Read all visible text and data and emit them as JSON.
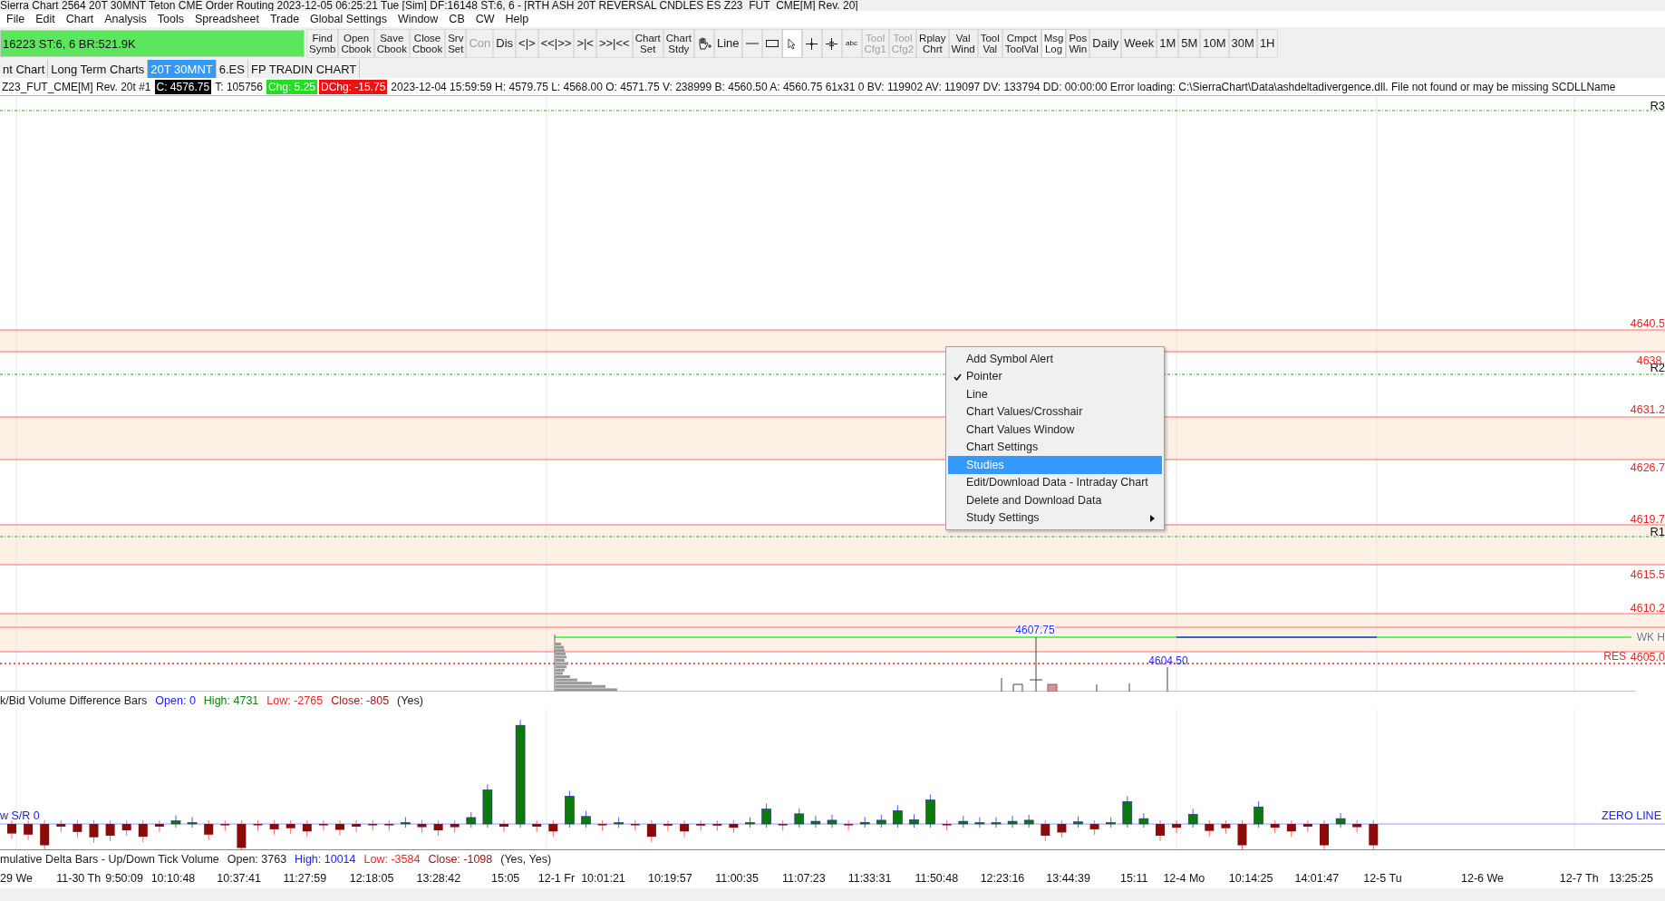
{
  "window": {
    "title": "Sierra Chart 2564 20T 30MNT Teton CME Order Routing 2023-12-05  06:25:21 Tue [Sim]  DF:16148  ST:6, 6 - [RTH ASH 20T REVERSAL CNDLES ES Z23_FUT_CME[M]  Rev. 20]"
  },
  "menu": [
    "File",
    "Edit",
    "Chart",
    "Analysis",
    "Tools",
    "Spreadsheet",
    "Trade",
    "Global Settings",
    "Window",
    "CB",
    "CW",
    "Help"
  ],
  "status_field": "16223  ST:6, 6  BR:521.9K",
  "toolbar": [
    {
      "kind": "text",
      "lines": [
        "Find",
        "Symb"
      ],
      "disabled": false,
      "pressed": false
    },
    {
      "kind": "text",
      "lines": [
        "Open",
        "Cbook"
      ],
      "disabled": false,
      "pressed": false
    },
    {
      "kind": "text",
      "lines": [
        "Save",
        "Cbook"
      ],
      "disabled": false,
      "pressed": false
    },
    {
      "kind": "text",
      "lines": [
        "Close",
        "Cbook"
      ],
      "disabled": false,
      "pressed": false
    },
    {
      "kind": "text",
      "lines": [
        "Srv",
        "Set"
      ],
      "disabled": false,
      "pressed": false
    },
    {
      "kind": "text",
      "lines": [
        "Con"
      ],
      "disabled": true,
      "pressed": false
    },
    {
      "kind": "text",
      "lines": [
        "Dis"
      ],
      "disabled": false,
      "pressed": false
    },
    {
      "kind": "text",
      "lines": [
        "<|>"
      ],
      "disabled": false,
      "pressed": false
    },
    {
      "kind": "text",
      "lines": [
        "<<|>>"
      ],
      "disabled": false,
      "pressed": false
    },
    {
      "kind": "text",
      "lines": [
        ">|<"
      ],
      "disabled": false,
      "pressed": false
    },
    {
      "kind": "text",
      "lines": [
        ">>|<<"
      ],
      "disabled": false,
      "pressed": false
    },
    {
      "kind": "text",
      "lines": [
        "Chart",
        "Set"
      ],
      "disabled": false,
      "pressed": false
    },
    {
      "kind": "text",
      "lines": [
        "Chart",
        "Stdy"
      ],
      "disabled": false,
      "pressed": false
    },
    {
      "kind": "hand",
      "disabled": false,
      "pressed": false
    },
    {
      "kind": "text",
      "lines": [
        "Line"
      ],
      "disabled": false,
      "pressed": false
    },
    {
      "kind": "dash",
      "disabled": false,
      "pressed": false
    },
    {
      "kind": "rectangle",
      "disabled": false,
      "pressed": false
    },
    {
      "kind": "pointer",
      "disabled": false,
      "pressed": true
    },
    {
      "kind": "crosshair",
      "disabled": false,
      "pressed": false
    },
    {
      "kind": "cross",
      "disabled": false,
      "pressed": false
    },
    {
      "kind": "small",
      "lines": [
        "abc"
      ],
      "disabled": false,
      "pressed": false
    },
    {
      "kind": "text",
      "lines": [
        "Tool",
        "Cfg1"
      ],
      "disabled": true,
      "pressed": false
    },
    {
      "kind": "text",
      "lines": [
        "Tool",
        "Cfg2"
      ],
      "disabled": true,
      "pressed": false
    },
    {
      "kind": "text",
      "lines": [
        "Rplay",
        "Chrt"
      ],
      "disabled": false,
      "pressed": false
    },
    {
      "kind": "text",
      "lines": [
        "Val",
        "Wind"
      ],
      "disabled": false,
      "pressed": false
    },
    {
      "kind": "text",
      "lines": [
        "Tool",
        "Val"
      ],
      "disabled": false,
      "pressed": false
    },
    {
      "kind": "text",
      "lines": [
        "Cmpct",
        "ToolVal"
      ],
      "disabled": false,
      "pressed": false
    },
    {
      "kind": "text",
      "lines": [
        "Msg",
        "Log"
      ],
      "disabled": false,
      "pressed": true
    },
    {
      "kind": "text",
      "lines": [
        "Pos",
        "Win"
      ],
      "disabled": false,
      "pressed": false
    },
    {
      "kind": "text",
      "lines": [
        "Daily"
      ],
      "disabled": false,
      "pressed": false
    },
    {
      "kind": "text",
      "lines": [
        "Week"
      ],
      "disabled": false,
      "pressed": false
    },
    {
      "kind": "text",
      "lines": [
        "1M"
      ],
      "disabled": false,
      "pressed": false
    },
    {
      "kind": "text",
      "lines": [
        "5M"
      ],
      "disabled": false,
      "pressed": false
    },
    {
      "kind": "text",
      "lines": [
        "10M"
      ],
      "disabled": false,
      "pressed": false
    },
    {
      "kind": "text",
      "lines": [
        "30M"
      ],
      "disabled": false,
      "pressed": false
    },
    {
      "kind": "text",
      "lines": [
        "1H"
      ],
      "disabled": false,
      "pressed": false
    }
  ],
  "tabs": [
    {
      "label": "nt Chart",
      "selected": false
    },
    {
      "label": "Long Term Charts",
      "selected": false
    },
    {
      "label": "20T 30MNT",
      "selected": true
    },
    {
      "label": "6.ES",
      "selected": false
    },
    {
      "label": "FP TRADIN CHART",
      "selected": false
    }
  ],
  "info_line": [
    {
      "kind": "plain",
      "text": "Z23_FUT_CME[M]  Rev. 20t #1"
    },
    {
      "kind": "last",
      "text": "C: 4576.75"
    },
    {
      "kind": "plain",
      "text": "T: 105756"
    },
    {
      "kind": "up",
      "text": "Chg: 5.25"
    },
    {
      "kind": "down",
      "text": "DChg: -15.75"
    },
    {
      "kind": "plain",
      "text": "2023-12-04 15:59:59 H: 4579.75 L: 4568.00 O: 4571.75 V: 238999 B: 4560.50 A: 4560.75 61x31 0 BV: 119902 AV: 119097 DV: 133794 DD: 00:00:00 Error loading: C:\\SierraChart\\Data\\ashdeltadivergence.dll. File not found or may be missing SCDLLName"
    }
  ],
  "chart": {
    "pivots": [
      {
        "label": "R3"
      },
      {
        "label": "R2"
      },
      {
        "label": "R1"
      }
    ],
    "price_levels": [
      {
        "label": "4640.5"
      },
      {
        "label": "4638."
      },
      {
        "label": "4631.2"
      },
      {
        "label": "4626.7"
      },
      {
        "label": "4619.7"
      },
      {
        "label": "4615.5"
      },
      {
        "label": "4610.2"
      },
      {
        "label": "4605.0"
      }
    ],
    "markers": [
      {
        "kind": "high",
        "text": "4607.75"
      },
      {
        "kind": "low",
        "text": "4604.50"
      },
      {
        "kind": "week",
        "text": "WK H"
      },
      {
        "kind": "res",
        "text": "RES"
      }
    ]
  },
  "context_menu": [
    {
      "label": "Add Symbol Alert",
      "checked": false,
      "selected": false,
      "submenu": false
    },
    {
      "label": "Pointer",
      "checked": true,
      "selected": false,
      "submenu": false
    },
    {
      "label": "Line",
      "checked": false,
      "selected": false,
      "submenu": false
    },
    {
      "label": "Chart Values/Crosshair",
      "checked": false,
      "selected": false,
      "submenu": false
    },
    {
      "label": "Chart Values Window",
      "checked": false,
      "selected": false,
      "submenu": false
    },
    {
      "label": "Chart Settings",
      "checked": false,
      "selected": false,
      "submenu": false
    },
    {
      "label": "Studies",
      "checked": false,
      "selected": true,
      "submenu": false
    },
    {
      "label": "Edit/Download Data - Intraday Chart",
      "checked": false,
      "selected": false,
      "submenu": false
    },
    {
      "label": "Delete and Download Data",
      "checked": false,
      "selected": false,
      "submenu": false
    },
    {
      "label": "Study Settings",
      "checked": false,
      "selected": false,
      "submenu": true
    }
  ],
  "study_1": {
    "parts": [
      {
        "text": "k/Bid Volume Difference Bars",
        "color": "#202020"
      },
      {
        "text": "Open: 0",
        "color": "#2020ff"
      },
      {
        "text": "High: 4731",
        "color": "#108010"
      },
      {
        "text": "Low: -2765",
        "color": "#ff2020"
      },
      {
        "text": "Close: -805",
        "color": "#a01818"
      },
      {
        "text": "(Yes)",
        "color": "#202020"
      }
    ],
    "left_label": "w S/R  0",
    "right_label": "ZERO LINE"
  },
  "study_2": {
    "parts": [
      {
        "text": "mulative Delta Bars - Up/Down Tick Volume",
        "color": "#202020"
      },
      {
        "text": "Open: 3763",
        "color": "#202020"
      },
      {
        "text": "High: 10014",
        "color": "#2020ff"
      },
      {
        "text": "Low: -3584",
        "color": "#ff2020"
      },
      {
        "text": "Close: -1098",
        "color": "#a01818"
      },
      {
        "text": "(Yes, Yes)",
        "color": "#202020"
      }
    ]
  },
  "time_axis": [
    "29 We",
    "11-30 Th",
    "9:50:09",
    "10:10:48",
    "10:37:41",
    "11:27:59",
    "12:18:05",
    "13:28:42",
    "15:05",
    "12-1 Fr",
    "10:01:21",
    "10:19:57",
    "11:00:35",
    "11:07:23",
    "11:33:31",
    "11:50:48",
    "12:23:16",
    "13:44:39",
    "15:11",
    "12-4 Mo",
    "10:14:25",
    "14:01:47",
    "12-5 Tu",
    "12-6 We",
    "12-7 Th",
    "13:25:25"
  ]
}
